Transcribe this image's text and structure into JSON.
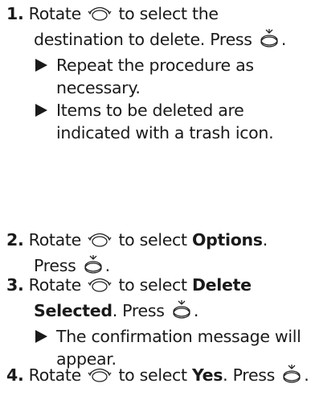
{
  "step1": {
    "number": "1.",
    "text_a": "Rotate",
    "text_b": "to select the",
    "text_c": "destination to delete. Press",
    "text_d": ".",
    "bullets": [
      {
        "line1": "Repeat the procedure as",
        "line2": "necessary."
      },
      {
        "line1": "Items to be deleted are",
        "line2": "indicated with a trash icon."
      }
    ]
  },
  "step2": {
    "number": "2.",
    "text_a": "Rotate",
    "text_b": "to select",
    "bold": "Options",
    "text_c": ".",
    "text_d": "Press",
    "text_e": "."
  },
  "step3": {
    "number": "3.",
    "text_a": "Rotate",
    "text_b": "to select",
    "bold_a": "Delete",
    "bold_b": "Selected",
    "text_c": ". Press",
    "text_d": ".",
    "bullet": {
      "line1": "The confirmation message will",
      "line2": "appear."
    }
  },
  "step4": {
    "number": "4.",
    "text_a": "Rotate",
    "text_b": "to select",
    "bold": "Yes",
    "text_c": ". Press",
    "text_d": "."
  },
  "icons": {
    "rotate": "interface-dial-rotate-icon",
    "press": "interface-dial-press-icon"
  }
}
